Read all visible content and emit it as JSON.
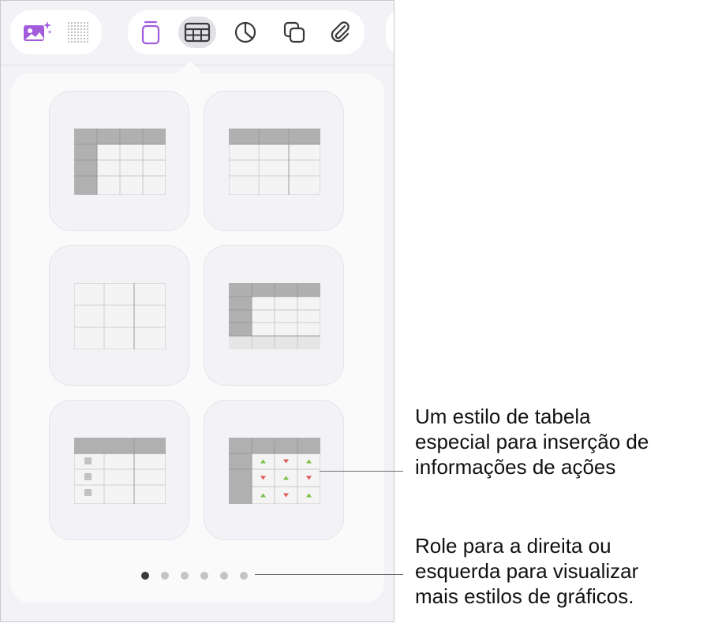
{
  "toolbar": {
    "left_buttons": [
      {
        "name": "media-icon"
      },
      {
        "name": "grid-icon"
      }
    ],
    "buttons": [
      {
        "name": "text-icon"
      },
      {
        "name": "table-icon",
        "selected": true
      },
      {
        "name": "chart-icon"
      },
      {
        "name": "shape-icon"
      },
      {
        "name": "attachment-icon"
      }
    ],
    "accent_color": "#a35cdc",
    "icon_color": "#3a3a3c"
  },
  "styles": [
    {
      "name": "table-style-header-row-column"
    },
    {
      "name": "table-style-header-row"
    },
    {
      "name": "table-style-plain"
    },
    {
      "name": "table-style-header-row-column-footer"
    },
    {
      "name": "table-style-checklist"
    },
    {
      "name": "table-style-stocks"
    }
  ],
  "pagination": {
    "count": 6,
    "current": 0
  },
  "callouts": [
    {
      "lines": [
        "Um estilo de tabela",
        "especial para inserção de",
        "informações de ações"
      ]
    },
    {
      "lines": [
        "Role para a direita ou",
        "esquerda para visualizar",
        "mais estilos de gráficos."
      ]
    }
  ],
  "stock_colors": {
    "up": "#7cc247",
    "down": "#e05a55"
  }
}
